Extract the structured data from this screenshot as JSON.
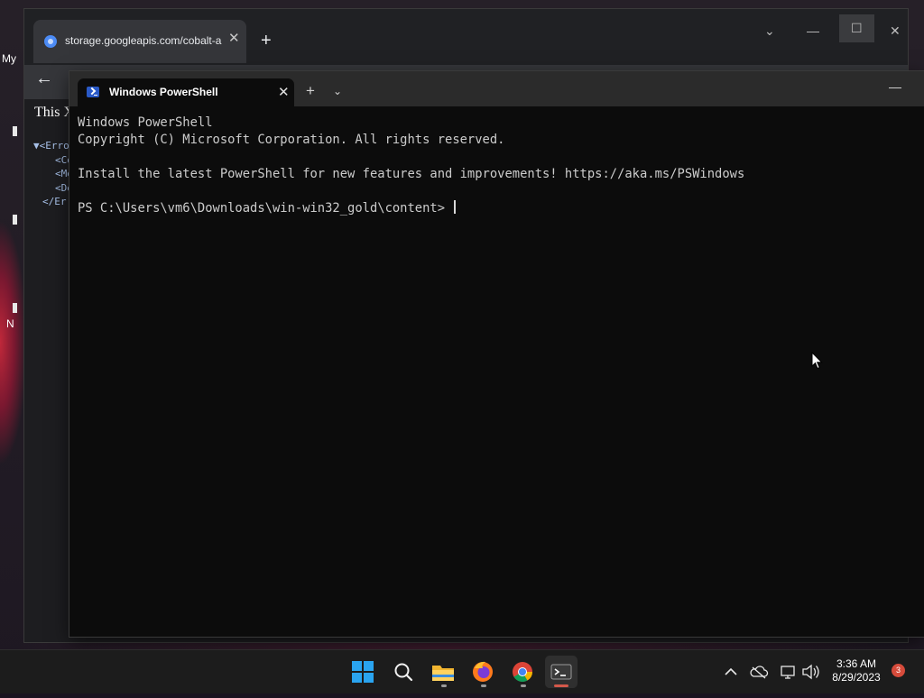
{
  "desktop": {
    "label_fragment": "My",
    "label_fragment_2": "N"
  },
  "browser": {
    "tab_title": "storage.googleapis.com/cobalt-a",
    "close_glyph": "✕",
    "new_tab_glyph": "+",
    "back_glyph": "←",
    "window_controls": {
      "chevron": "⌄",
      "minimize": "—",
      "maximize": "☐",
      "close": "✕"
    },
    "xml_note": "This X",
    "xml_tree": [
      "▼<Erro",
      "<Co",
      "<Me",
      "<De",
      "</Er"
    ]
  },
  "terminal": {
    "tab_title": "Windows PowerShell",
    "close_glyph": "✕",
    "new_tab_glyph": "+",
    "dropdown_glyph": "⌄",
    "minimize_glyph": "—",
    "lines": {
      "l1": "Windows PowerShell",
      "l2": "Copyright (C) Microsoft Corporation. All rights reserved.",
      "l3": "",
      "l4": "Install the latest PowerShell for new features and improvements! https://aka.ms/PSWindows",
      "l5": "",
      "prompt": "PS C:\\Users\\vm6\\Downloads\\win-win32_gold\\content>"
    }
  },
  "taskbar": {
    "apps": [
      "start-icon",
      "search-icon",
      "file-explorer-icon",
      "firefox-icon",
      "chrome-icon",
      "terminal-icon"
    ],
    "active_app": "terminal-icon",
    "tray": [
      "chevron-up-icon",
      "onedrive-icon",
      "network-icon",
      "volume-icon"
    ],
    "clock_time": "3:36 AM",
    "clock_date": "8/29/2023",
    "notification_count": "3",
    "accent_color": "#d3584a"
  }
}
